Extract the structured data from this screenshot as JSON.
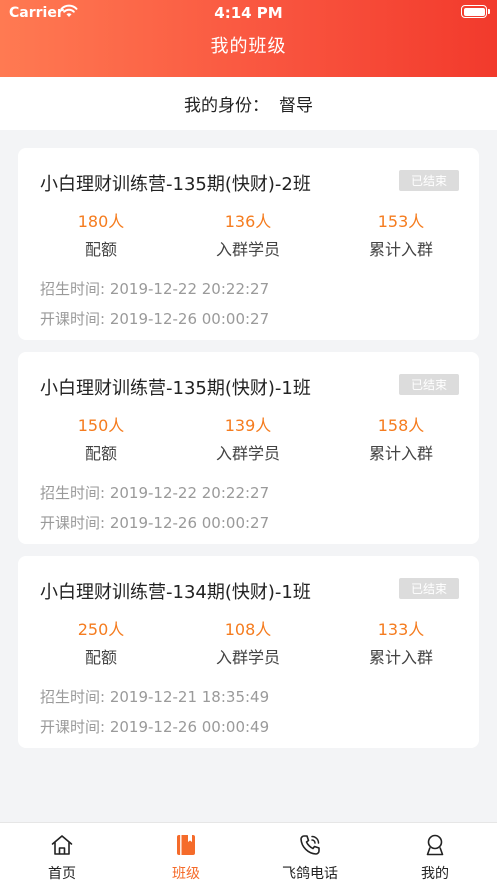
{
  "status_bar": {
    "carrier": "Carrier",
    "time": "4:14 PM"
  },
  "nav": {
    "title": "我的班级"
  },
  "identity": {
    "label": "我的身份：",
    "value": "督导"
  },
  "accent_color": "#f57c1f",
  "classes": [
    {
      "title": "小白理财训练营-135期(快财)-2班",
      "status": "已结束",
      "stats": [
        {
          "value": "180人",
          "label": "配额"
        },
        {
          "value": "136人",
          "label": "入群学员"
        },
        {
          "value": "153人",
          "label": "累计入群"
        }
      ],
      "enroll_time": "招生时间: 2019-12-22 20:22:27",
      "start_time": "开课时间: 2019-12-26 00:00:27"
    },
    {
      "title": "小白理财训练营-135期(快财)-1班",
      "status": "已结束",
      "stats": [
        {
          "value": "150人",
          "label": "配额"
        },
        {
          "value": "139人",
          "label": "入群学员"
        },
        {
          "value": "158人",
          "label": "累计入群"
        }
      ],
      "enroll_time": "招生时间: 2019-12-22 20:22:27",
      "start_time": "开课时间: 2019-12-26 00:00:27"
    },
    {
      "title": "小白理财训练营-134期(快财)-1班",
      "status": "已结束",
      "stats": [
        {
          "value": "250人",
          "label": "配额"
        },
        {
          "value": "108人",
          "label": "入群学员"
        },
        {
          "value": "133人",
          "label": "累计入群"
        }
      ],
      "enroll_time": "招生时间: 2019-12-21 18:35:49",
      "start_time": "开课时间: 2019-12-26 00:00:49"
    }
  ],
  "tabs": [
    {
      "label": "首页",
      "icon": "home-icon",
      "active": false
    },
    {
      "label": "班级",
      "icon": "class-book-icon",
      "active": true
    },
    {
      "label": "飞鸽电话",
      "icon": "phone-icon",
      "active": false
    },
    {
      "label": "我的",
      "icon": "user-icon",
      "active": false
    }
  ]
}
